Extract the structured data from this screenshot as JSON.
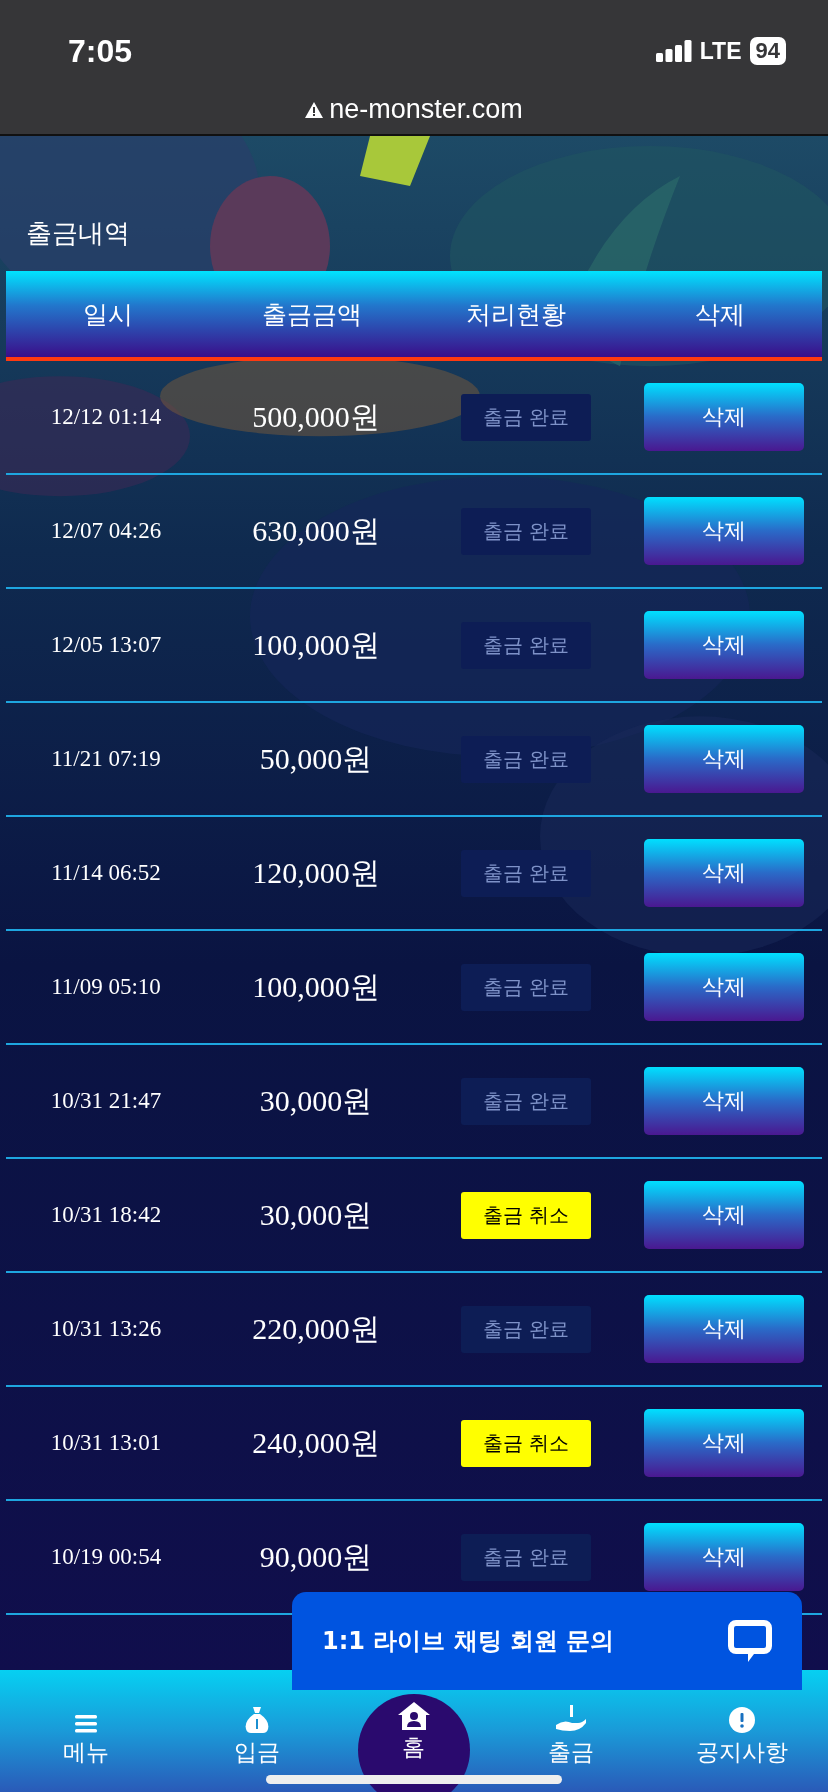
{
  "status_bar": {
    "time": "7:05",
    "network": "LTE",
    "battery": "94"
  },
  "browser": {
    "url": "ne-monster.com"
  },
  "section_title": "출금내역",
  "table": {
    "columns": [
      "일시",
      "출금금액",
      "처리현황",
      "삭제"
    ],
    "rows": [
      {
        "date": "12/12 01:14",
        "amount": "500,000원",
        "status": "출금 완료",
        "kind": "done",
        "action": "삭제"
      },
      {
        "date": "12/07 04:26",
        "amount": "630,000원",
        "status": "출금 완료",
        "kind": "done",
        "action": "삭제"
      },
      {
        "date": "12/05 13:07",
        "amount": "100,000원",
        "status": "출금 완료",
        "kind": "done",
        "action": "삭제"
      },
      {
        "date": "11/21 07:19",
        "amount": "50,000원",
        "status": "출금 완료",
        "kind": "done",
        "action": "삭제"
      },
      {
        "date": "11/14 06:52",
        "amount": "120,000원",
        "status": "출금 완료",
        "kind": "done",
        "action": "삭제"
      },
      {
        "date": "11/09 05:10",
        "amount": "100,000원",
        "status": "출금 완료",
        "kind": "done",
        "action": "삭제"
      },
      {
        "date": "10/31 21:47",
        "amount": "30,000원",
        "status": "출금 완료",
        "kind": "done",
        "action": "삭제"
      },
      {
        "date": "10/31 18:42",
        "amount": "30,000원",
        "status": "출금 취소",
        "kind": "cancel",
        "action": "삭제"
      },
      {
        "date": "10/31 13:26",
        "amount": "220,000원",
        "status": "출금 완료",
        "kind": "done",
        "action": "삭제"
      },
      {
        "date": "10/31 13:01",
        "amount": "240,000원",
        "status": "출금 취소",
        "kind": "cancel",
        "action": "삭제"
      },
      {
        "date": "10/19 00:54",
        "amount": "90,000원",
        "status": "출금 완료",
        "kind": "done",
        "action": "삭제"
      }
    ]
  },
  "chat": {
    "label": "1:1 라이브 채팅 회원 문의"
  },
  "bottom_nav": [
    {
      "label": "메뉴",
      "kind": "menu",
      "selected": false
    },
    {
      "label": "입금",
      "kind": "deposit",
      "selected": false
    },
    {
      "label": "홈",
      "kind": "home",
      "selected": true
    },
    {
      "label": "출금",
      "kind": "withdraw",
      "selected": false
    },
    {
      "label": "공지사항",
      "kind": "notice",
      "selected": false
    }
  ]
}
